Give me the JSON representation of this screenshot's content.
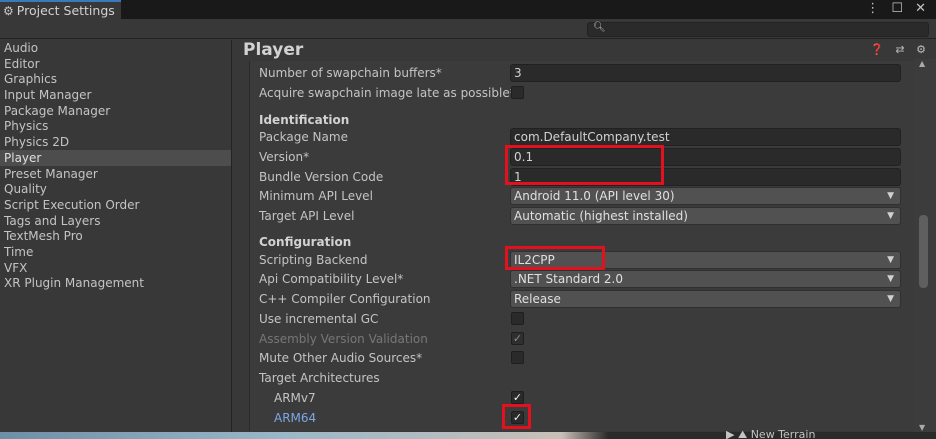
{
  "window": {
    "tab_title": "Project Settings",
    "controls": "⋮ ☐ ✕"
  },
  "search": {
    "placeholder": ""
  },
  "sidebar": {
    "items": [
      {
        "label": "Audio"
      },
      {
        "label": "Editor"
      },
      {
        "label": "Graphics"
      },
      {
        "label": "Input Manager"
      },
      {
        "label": "Package Manager"
      },
      {
        "label": "Physics"
      },
      {
        "label": "Physics 2D"
      },
      {
        "label": "Player",
        "selected": true
      },
      {
        "label": "Preset Manager"
      },
      {
        "label": "Quality"
      },
      {
        "label": "Script Execution Order"
      },
      {
        "label": "Tags and Layers"
      },
      {
        "label": "TextMesh Pro"
      },
      {
        "label": "Time"
      },
      {
        "label": "VFX"
      },
      {
        "label": "XR Plugin Management"
      }
    ]
  },
  "main": {
    "title": "Player",
    "title_icons": "❓ ⇄ ⚙",
    "rows": {
      "swapchain_buffers": {
        "label": "Number of swapchain buffers*",
        "value": "3"
      },
      "acquire_late": {
        "label": "Acquire swapchain image late as possible*",
        "checked": false
      },
      "identification_header": "Identification",
      "package_name": {
        "label": "Package Name",
        "value": "com.DefaultCompany.test"
      },
      "version": {
        "label": "Version*",
        "value": "0.1"
      },
      "bundle_version_code": {
        "label": "Bundle Version Code",
        "value": "1"
      },
      "min_api_level": {
        "label": "Minimum API Level",
        "value": "Android 11.0 (API level 30)"
      },
      "target_api_level": {
        "label": "Target API Level",
        "value": "Automatic (highest installed)"
      },
      "configuration_header": "Configuration",
      "scripting_backend": {
        "label": "Scripting Backend",
        "value": "IL2CPP"
      },
      "api_compat": {
        "label": "Api Compatibility Level*",
        "value": ".NET Standard 2.0"
      },
      "cpp_compiler": {
        "label": "C++ Compiler Configuration",
        "value": "Release"
      },
      "incremental_gc": {
        "label": "Use incremental GC",
        "checked": false
      },
      "assembly_validation": {
        "label": "Assembly Version Validation",
        "checked": true
      },
      "mute_audio": {
        "label": "Mute Other Audio Sources*",
        "checked": false
      },
      "target_arch": {
        "label": "Target Architectures"
      },
      "armv7": {
        "label": "ARMv7",
        "checked": true
      },
      "arm64": {
        "label": "ARM64",
        "checked": true
      }
    }
  },
  "bottom_strip": {
    "item": "▶ ⛰ New Terrain"
  },
  "colors": {
    "highlight": "#e3101d",
    "accent": "#3a79bb",
    "background": "#383838"
  }
}
